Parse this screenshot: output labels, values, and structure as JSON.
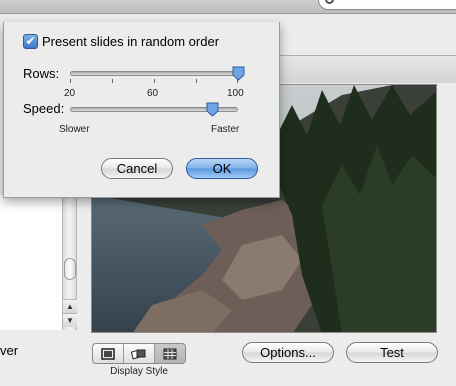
{
  "background": {
    "side_text": "ver",
    "display_style_label": "Display Style",
    "options_button": "Options...",
    "test_button": "Test",
    "display_style_options": [
      "single-image-icon",
      "collage-icon",
      "mosaic-grid-icon"
    ],
    "selected_display_style": "mosaic-grid-icon"
  },
  "dialog": {
    "random_order": {
      "label": "Present slides in random order",
      "checked": true,
      "check_glyph": "✔"
    },
    "rows": {
      "label": "Rows:",
      "tick_labels": [
        "20",
        "60",
        "100"
      ],
      "min": 20,
      "max": 100,
      "value": 100
    },
    "speed": {
      "label": "Speed:",
      "min_label": "Slower",
      "max_label": "Faster",
      "fraction": 0.85
    },
    "cancel_button": "Cancel",
    "ok_button": "OK"
  },
  "colors": {
    "default_button": "#5a97e0",
    "checkbox": "#3c79c9"
  }
}
